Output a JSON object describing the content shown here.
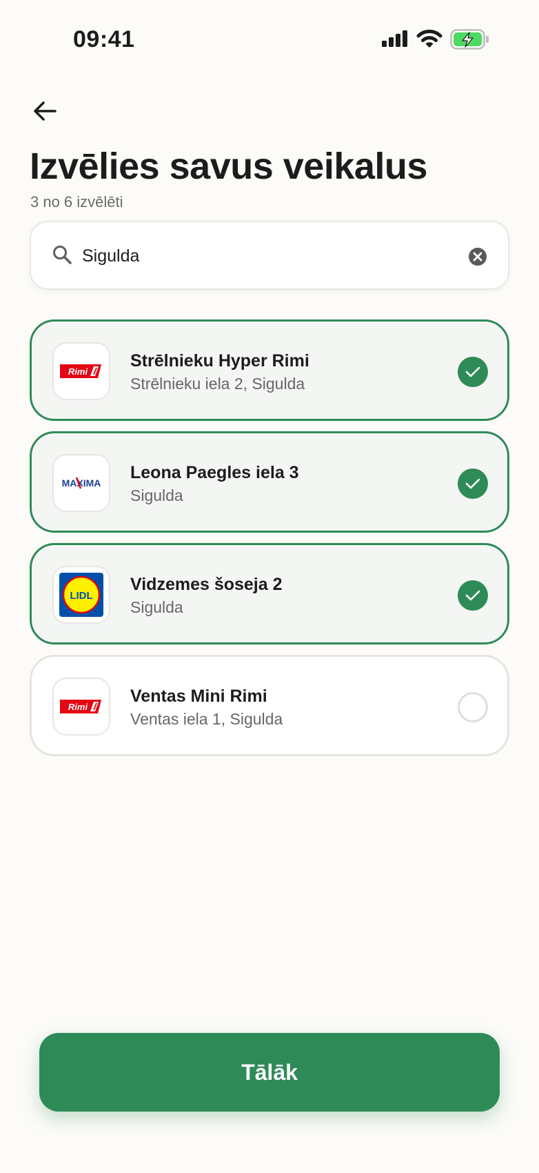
{
  "status_bar": {
    "time": "09:41"
  },
  "header": {
    "title": "Izvēlies savus veikalus",
    "selection_count": "3 no 6 izvēlēti"
  },
  "search": {
    "value": "Sigulda"
  },
  "stores": [
    {
      "brand": "rimi",
      "logo_text": "Rimi",
      "name": "Strēlnieku Hyper Rimi",
      "address": "Strēlnieku iela 2, Sigulda",
      "selected": true
    },
    {
      "brand": "maxima",
      "logo_text": "MAXIMA",
      "name": "Leona Paegles iela 3",
      "address": "Sigulda",
      "selected": true
    },
    {
      "brand": "lidl",
      "logo_text": "LIDL",
      "name": "Vidzemes šoseja 2",
      "address": "Sigulda",
      "selected": true
    },
    {
      "brand": "rimi",
      "logo_text": "Rimi",
      "name": "Ventas Mini Rimi",
      "address": "Ventas iela 1, Sigulda",
      "selected": false
    }
  ],
  "footer": {
    "next_label": "Tālāk"
  },
  "colors": {
    "accent": "#2e8b57",
    "rimi_red": "#e30613",
    "maxima_blue": "#1d3f95",
    "maxima_red": "#e30613",
    "lidl_blue": "#0050aa",
    "lidl_yellow": "#fff000"
  }
}
